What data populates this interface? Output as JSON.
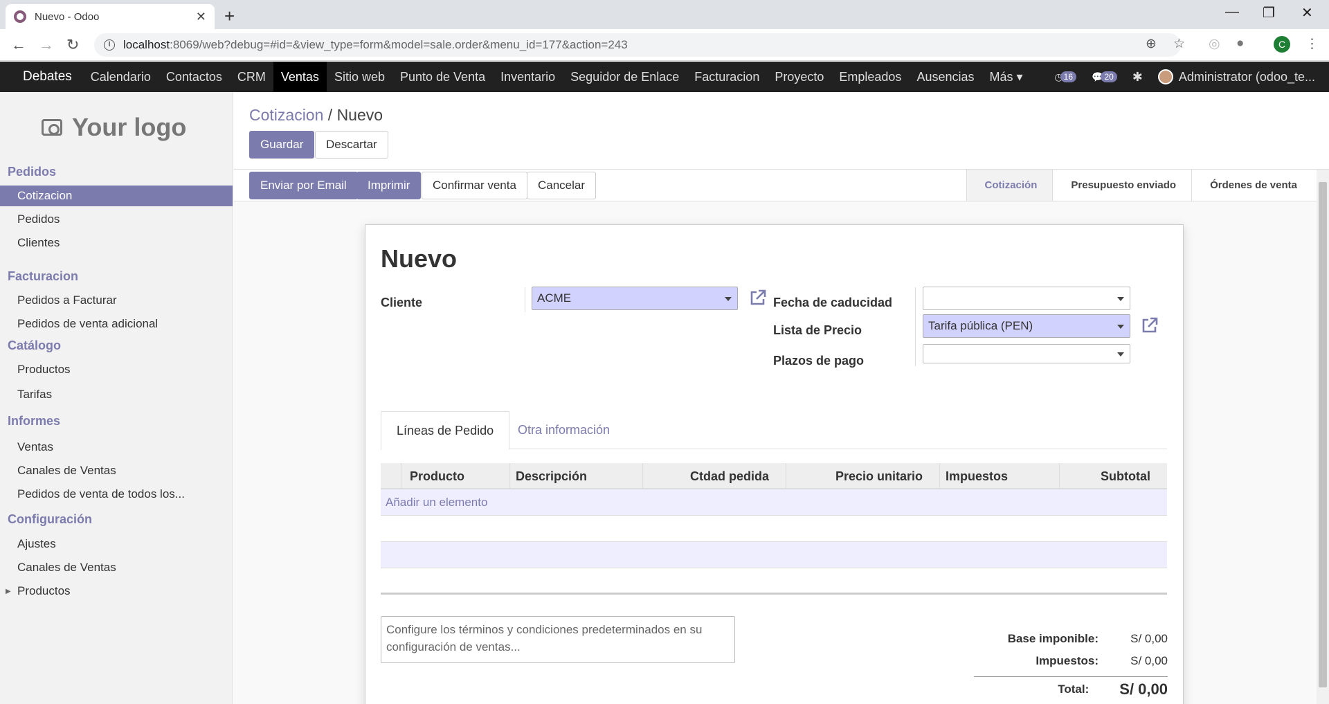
{
  "browser": {
    "tab_title": "Nuevo - Odoo",
    "url_host": "localhost",
    "url_path": ":8069/web?debug=#id=&view_type=form&model=sale.order&menu_id=177&action=243",
    "profile_initial": "C"
  },
  "navbar": {
    "brand": "Debates",
    "items": [
      "Calendario",
      "Contactos",
      "CRM",
      "Ventas",
      "Sitio web",
      "Punto de Venta",
      "Inventario",
      "Seguidor de Enlace",
      "Facturacion",
      "Proyecto",
      "Empleados",
      "Ausencias",
      "Más"
    ],
    "active": "Ventas",
    "activity_count": "16",
    "message_count": "20",
    "user": "Administrator (odoo_te..."
  },
  "sidebar": {
    "logo_text": "Your logo",
    "sections": [
      {
        "title": "Pedidos",
        "items": [
          "Cotizacion",
          "Pedidos",
          "Clientes"
        ]
      },
      {
        "title": "Facturacion",
        "items": [
          "Pedidos a Facturar",
          "Pedidos de venta adicional"
        ]
      },
      {
        "title": "Catálogo",
        "items": [
          "Productos",
          "Tarifas"
        ]
      },
      {
        "title": "Informes",
        "items": [
          "Ventas",
          "Canales de Ventas",
          "Pedidos de venta de todos los..."
        ]
      },
      {
        "title": "Configuración",
        "items": [
          "Ajustes",
          "Canales de Ventas",
          "Productos"
        ]
      }
    ],
    "active_item": "Cotizacion"
  },
  "control_panel": {
    "breadcrumb_parent": "Cotizacion",
    "breadcrumb_sep": " / ",
    "breadcrumb_current": "Nuevo",
    "save_label": "Guardar",
    "discard_label": "Descartar"
  },
  "statusbar": {
    "buttons": [
      "Enviar por Email",
      "Imprimir",
      "Confirmar venta",
      "Cancelar"
    ],
    "stages": [
      "Cotización",
      "Presupuesto enviado",
      "Órdenes de venta"
    ],
    "current_stage": "Cotización"
  },
  "form": {
    "title": "Nuevo",
    "customer_label": "Cliente",
    "customer_value": "ACME",
    "expiration_label": "Fecha de caducidad",
    "expiration_value": "",
    "pricelist_label": "Lista de Precio",
    "pricelist_value": "Tarifa pública (PEN)",
    "payment_terms_label": "Plazos de pago",
    "payment_terms_value": "",
    "tabs": [
      "Líneas de Pedido",
      "Otra información"
    ],
    "columns": [
      "Producto",
      "Descripción",
      "Ctdad pedida",
      "Precio unitario",
      "Impuestos",
      "Subtotal"
    ],
    "add_line": "Añadir un elemento",
    "note_placeholder": "Configure los términos y condiciones predeterminados en su configuración de ventas...",
    "untaxed_label": "Base imponible:",
    "untaxed_value": "S/ 0,00",
    "taxes_label": "Impuestos:",
    "taxes_value": "S/ 0,00",
    "total_label": "Total:",
    "total_value": "S/ 0,00"
  },
  "colors": {
    "accent": "#7c7bad",
    "navbar": "#212121",
    "required_field": "#d2d2ff"
  }
}
